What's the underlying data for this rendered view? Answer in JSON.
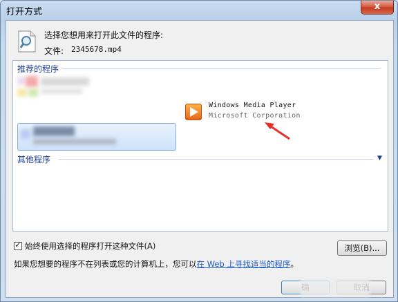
{
  "window": {
    "title": "打开方式",
    "close_label": "x"
  },
  "header": {
    "prompt": "选择您想用来打开此文件的程序:",
    "file_label": "文件:",
    "file_name": "2345678.mp4"
  },
  "programs": {
    "recommended_label": "推荐的程序",
    "other_label": "其他程序",
    "items": [
      {
        "name": "Windows Media Player",
        "company": "Microsoft Corporation",
        "icon": "media-player-icon"
      }
    ]
  },
  "options": {
    "always_use_label": "始终使用选择的程序打开这种文件(A)",
    "always_use_checked": true,
    "browse_label": "浏览(B)...",
    "help_prefix": "如果您想要的程序不在列表或您的计算机上，您可以",
    "help_link": "在 Web 上寻找适当的程序",
    "help_suffix": "。"
  },
  "buttons": {
    "ok_label": "确",
    "cancel_label": "取消"
  }
}
